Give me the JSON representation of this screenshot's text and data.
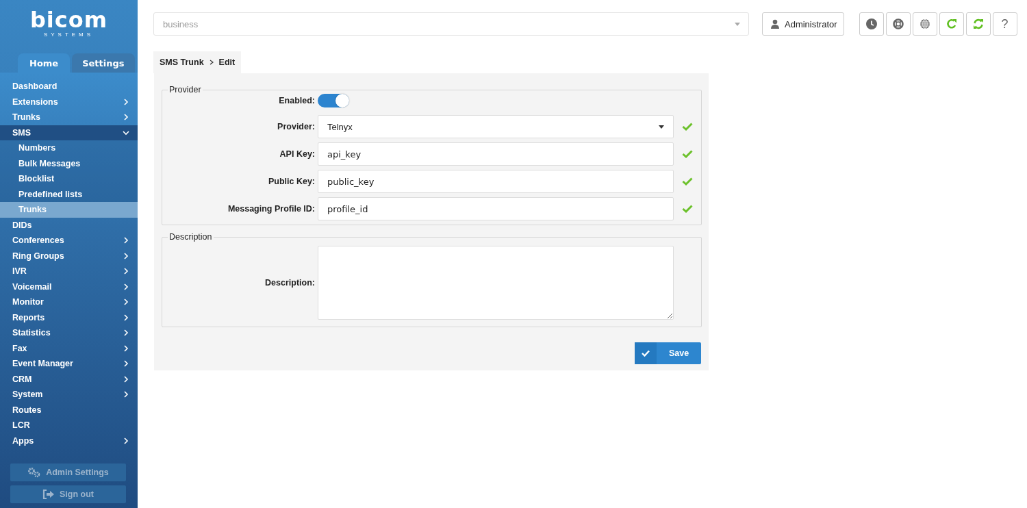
{
  "sidebar": {
    "logo": "bicom",
    "logo_sub": "SYSTEMS",
    "tabs": [
      {
        "label": "Home",
        "selected": true
      },
      {
        "label": "Settings",
        "selected": false
      }
    ],
    "items": [
      {
        "label": "Dashboard",
        "selected": false
      },
      {
        "label": "Extensions",
        "selected": false,
        "expanded": false
      },
      {
        "label": "Trunks",
        "selected": false,
        "expanded": false
      },
      {
        "label": "SMS",
        "selected": false,
        "expanded": true,
        "children": [
          {
            "label": "Numbers",
            "selected": false
          },
          {
            "label": "Bulk Messages",
            "selected": false
          },
          {
            "label": "Blocklist",
            "selected": false
          },
          {
            "label": "Predefined lists",
            "selected": false
          },
          {
            "label": "Trunks",
            "selected": true
          }
        ]
      },
      {
        "label": "DIDs",
        "selected": false
      },
      {
        "label": "Conferences",
        "selected": false,
        "expanded": false
      },
      {
        "label": "Ring Groups",
        "selected": false,
        "expanded": false
      },
      {
        "label": "IVR",
        "selected": false,
        "expanded": false
      },
      {
        "label": "Voicemail",
        "selected": false,
        "expanded": false
      },
      {
        "label": "Monitor",
        "selected": false,
        "expanded": false
      },
      {
        "label": "Reports",
        "selected": false,
        "expanded": false
      },
      {
        "label": "Statistics",
        "selected": false,
        "expanded": false
      },
      {
        "label": "Fax",
        "selected": false,
        "expanded": false
      },
      {
        "label": "Event Manager",
        "selected": false,
        "expanded": false
      },
      {
        "label": "CRM",
        "selected": false,
        "expanded": false
      },
      {
        "label": "System",
        "selected": false,
        "expanded": false
      },
      {
        "label": "Routes",
        "selected": false
      },
      {
        "label": "LCR",
        "selected": false
      },
      {
        "label": "Apps",
        "selected": false,
        "expanded": false
      }
    ],
    "buttons": [
      {
        "kind": "gears",
        "label": "Admin Settings"
      },
      {
        "kind": "signout",
        "label": "Sign out"
      }
    ]
  },
  "topbar": {
    "tenant_select": {
      "placeholder": "business"
    },
    "user_button": "Administrator",
    "icons": [
      {
        "kind": "clock"
      },
      {
        "kind": "lifebuoy"
      },
      {
        "kind": "globe"
      },
      {
        "kind": "reload"
      },
      {
        "kind": "sync"
      },
      {
        "kind": "help",
        "text": "?"
      }
    ]
  },
  "breadcrumb": [
    "SMS Trunk",
    "Edit"
  ],
  "sections": [
    {
      "legend": "Provider",
      "fields": [
        {
          "kind": "toggle",
          "label": "Enabled:",
          "on": true
        },
        {
          "kind": "select",
          "label": "Provider:",
          "value": "Telnyx",
          "valid": true
        },
        {
          "kind": "text",
          "label": "API Key:",
          "value": "api_key",
          "valid": true
        },
        {
          "kind": "text",
          "label": "Public Key:",
          "value": "public_key",
          "valid": true
        },
        {
          "kind": "text",
          "label": "Messaging Profile ID:",
          "value": "profile_id",
          "valid": true
        }
      ]
    },
    {
      "legend": "Description",
      "fields": [
        {
          "kind": "textarea",
          "label": "Description:",
          "valid": false
        }
      ]
    }
  ],
  "save_button": "Save"
}
